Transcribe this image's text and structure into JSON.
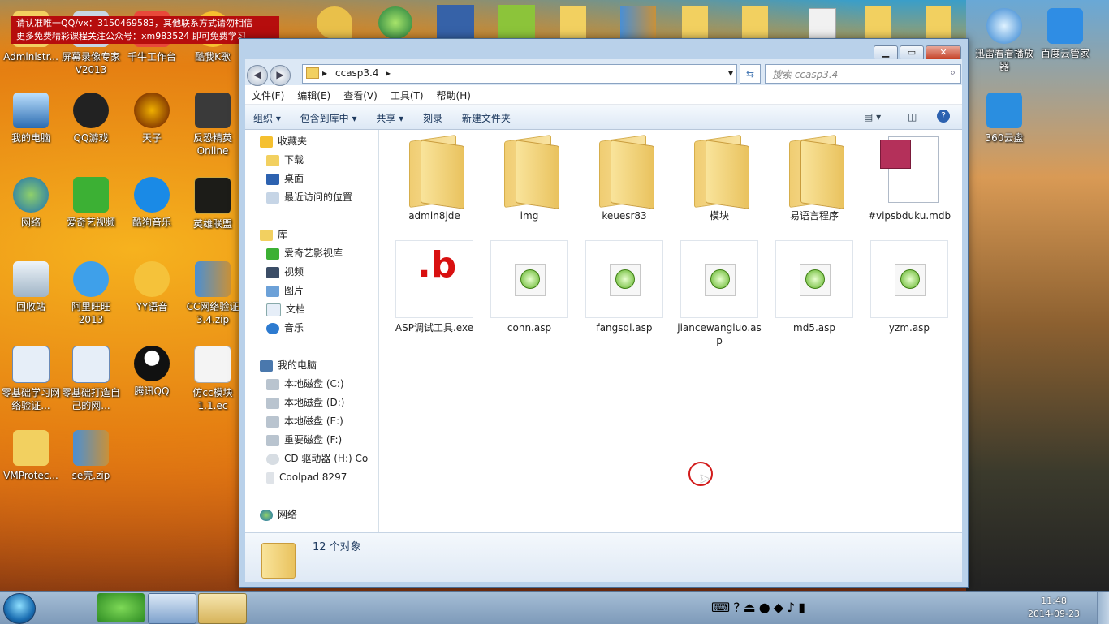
{
  "banner": {
    "line1": "请认准唯一QQ/vx：3150469583，其他联系方式请勿相信",
    "line2": "更多免费精彩课程关注公众号：xm983524 即可免费学习"
  },
  "desktop_icons": [
    {
      "label": "Administr..."
    },
    {
      "label": "屏幕录像专家V2013"
    },
    {
      "label": "千牛工作台"
    },
    {
      "label": "酷我K歌"
    },
    {
      "label": "我的电脑"
    },
    {
      "label": "QQ游戏"
    },
    {
      "label": "天子"
    },
    {
      "label": "反恐精英Online"
    },
    {
      "label": "网络"
    },
    {
      "label": "爱奇艺视频"
    },
    {
      "label": "酷狗音乐"
    },
    {
      "label": "英雄联盟"
    },
    {
      "label": "回收站"
    },
    {
      "label": "阿里旺旺2013"
    },
    {
      "label": "YY语音"
    },
    {
      "label": "CC网络验证3.4.zip"
    },
    {
      "label": "零基础学习网络验证..."
    },
    {
      "label": "零基础打造自己的网..."
    },
    {
      "label": "腾讯QQ"
    },
    {
      "label": "仿cc模块1.1.ec"
    },
    {
      "label": "VMProtec..."
    },
    {
      "label": "se壳.zip"
    },
    {
      "label": "迅雷看看播放器"
    },
    {
      "label": "百度云管家"
    },
    {
      "label": "360云盘"
    }
  ],
  "explorer": {
    "address": {
      "path_segment": "ccasp3.4"
    },
    "search": {
      "placeholder": "搜索 ccasp3.4"
    },
    "menu": [
      "文件(F)",
      "编辑(E)",
      "查看(V)",
      "工具(T)",
      "帮助(H)"
    ],
    "toolbar": [
      "组织 ▾",
      "包含到库中 ▾",
      "共享 ▾",
      "刻录",
      "新建文件夹"
    ],
    "nav": {
      "favorites": "收藏夹",
      "fav_items": [
        "下载",
        "桌面",
        "最近访问的位置"
      ],
      "libraries": "库",
      "lib_items": [
        "爱奇艺影视库",
        "视频",
        "图片",
        "文档",
        "音乐"
      ],
      "computer": "我的电脑",
      "drives": [
        "本地磁盘 (C:)",
        "本地磁盘 (D:)",
        "本地磁盘 (E:)",
        "重要磁盘 (F:)",
        "CD 驱动器 (H:) Co",
        "Coolpad 8297"
      ],
      "network": "网络"
    },
    "files": [
      {
        "name": "admin8jde",
        "type": "folder"
      },
      {
        "name": "img",
        "type": "folder"
      },
      {
        "name": "keuesr83",
        "type": "folder"
      },
      {
        "name": "模块",
        "type": "folder"
      },
      {
        "name": "易语言程序",
        "type": "folder"
      },
      {
        "name": "#vipsbduku.mdb",
        "type": "mdb"
      },
      {
        "name": "ASP调试工具.exe",
        "type": "exe"
      },
      {
        "name": "conn.asp",
        "type": "asp"
      },
      {
        "name": "fangsql.asp",
        "type": "asp"
      },
      {
        "name": "jiancewangluo.asp",
        "type": "asp"
      },
      {
        "name": "md5.asp",
        "type": "asp"
      },
      {
        "name": "yzm.asp",
        "type": "asp"
      }
    ],
    "status": "12 个对象"
  },
  "taskbar": {
    "time": "11:48",
    "date": "2014-09-23"
  }
}
